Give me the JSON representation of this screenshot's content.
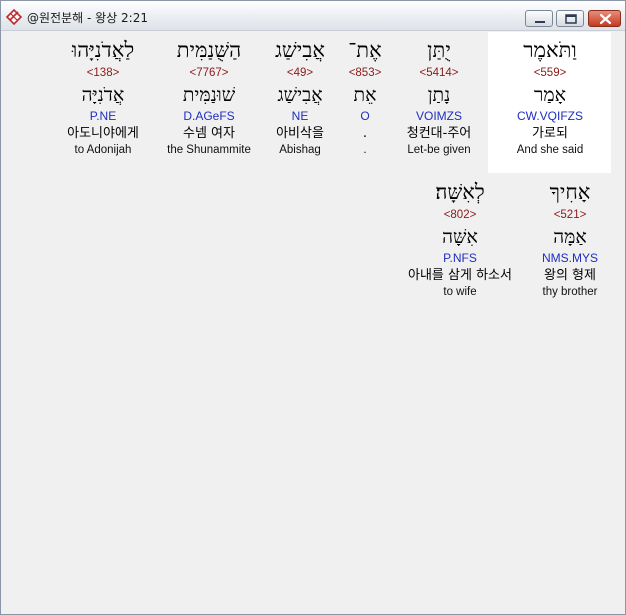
{
  "window": {
    "title": "@원전분해 - 왕상 2:21"
  },
  "row1": [
    {
      "hebrew": "וַתֹּאמֶר",
      "strong": "<559>",
      "lemma": "אָמַר",
      "morph": "CW.VQIFZS",
      "korean": "가로되",
      "english": "And she said"
    },
    {
      "hebrew": "יֻתַּן",
      "strong": "<5414>",
      "lemma": "נָתַן",
      "morph": "VOIMZS",
      "korean": "청컨대-주어",
      "english": "Let-be given"
    },
    {
      "hebrew": "אֶת־",
      "strong": "<853>",
      "lemma": "אֵת",
      "morph": "O",
      "korean": ".",
      "english": "."
    },
    {
      "hebrew": "אֲבִישַׁג",
      "strong": "<49>",
      "lemma": "אֲבִישַׁג",
      "morph": "NE",
      "korean": "아비삭을",
      "english": "Abishag"
    },
    {
      "hebrew": "הַשֻּׁנַמִּית",
      "strong": "<7767>",
      "lemma": "שׁוּנַמִּית",
      "morph": "D.AGeFS",
      "korean": "수넴 여자",
      "english": "the Shunammite"
    },
    {
      "hebrew": "לַאֲדֹנִיָּהוּ",
      "strong": "<138>",
      "lemma": "אֲדֹנִיָּה",
      "morph": "P.NE",
      "korean": "아도니야에게",
      "english": "to Adonijah"
    }
  ],
  "row2": [
    {
      "hebrew": "אָחִיךָ",
      "strong": "<521>",
      "lemma": "אַמָּה",
      "morph": "NMS.MYS",
      "korean": "왕의 형제",
      "english": "thy brother"
    },
    {
      "hebrew": "לְאִשָּׁה׃",
      "strong": "<802>",
      "lemma": "אִשָּׁה",
      "morph": "P.NFS",
      "korean": "아내를 삼게 하소서",
      "english": "to wife"
    }
  ]
}
